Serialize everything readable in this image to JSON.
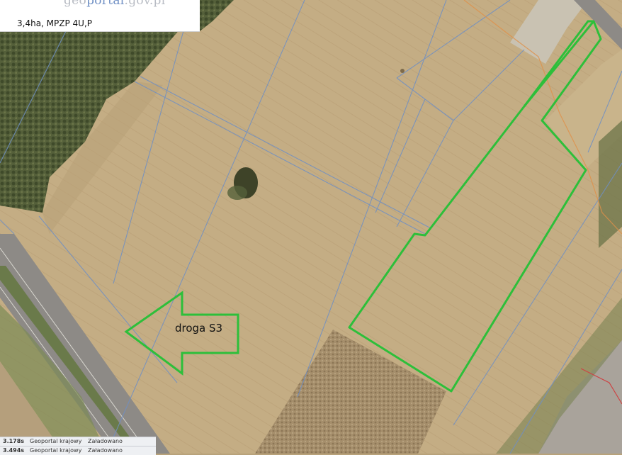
{
  "header": {
    "logo_left": "geo",
    "logo_mid": "portal",
    "logo_right": ".gov.pl",
    "parcel_info": "3,4ha, MPZP 4U,P"
  },
  "annotation": {
    "arrow_label": "droga S3",
    "outline_color": "#2dbf3a"
  },
  "status_rows": [
    {
      "time": "3.178s",
      "source": "Geoportal krajowy",
      "state": "Załadowano"
    },
    {
      "time": "3.494s",
      "source": "Geoportal krajowy",
      "state": "Załadowano"
    }
  ],
  "colors": {
    "field": "#c4ad84",
    "forest": "#56603a",
    "road": "#8d8a86",
    "parcel_lines": "#6f8fc4",
    "boundary_line": "#e09048"
  }
}
